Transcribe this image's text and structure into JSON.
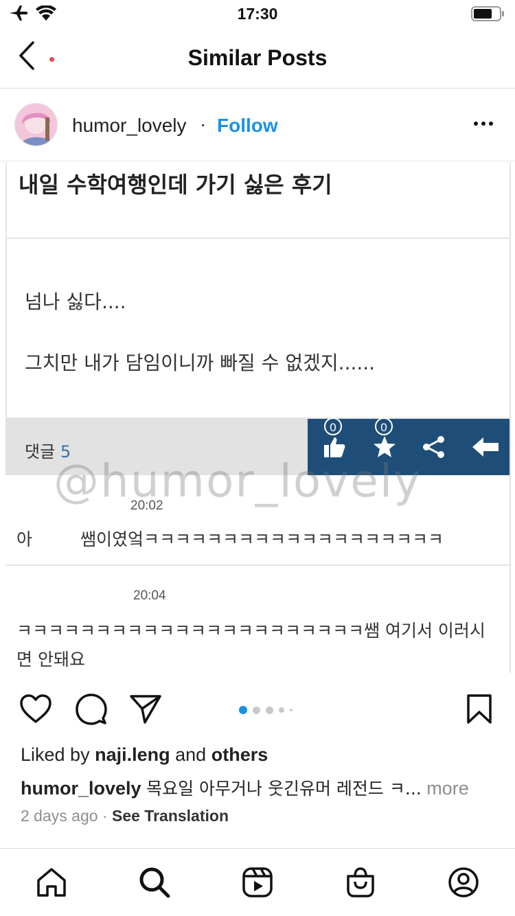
{
  "status_bar": {
    "time": "17:30"
  },
  "header": {
    "title": "Similar Posts"
  },
  "post": {
    "username": "humor_lovely",
    "separator": "·",
    "follow_label": "Follow"
  },
  "image_content": {
    "title": "내일 수학여행인데 가기 싫은 후기",
    "line1": "넘나 싫다....",
    "line2": "그치만 내가 담임이니까 빠질 수 없겠지......",
    "comment_label": "댓글",
    "comment_count": "5",
    "like_count": "0",
    "star_count": "0",
    "watermark": "@humor_lovely",
    "comment1_time": "20:02",
    "comment1_author": "아",
    "comment1_text": "쌤이였엌ㅋㅋㅋㅋㅋㅋㅋㅋㅋㅋㅋㅋㅋㅋㅋㅋㅋㅋㅋ",
    "comment2_time": "20:04",
    "comment2_text": "ㅋㅋㅋㅋㅋㅋㅋㅋㅋㅋㅋㅋㅋㅋㅋㅋㅋㅋㅋㅋㅋㅋ쌤 여기서 이러시면 안돼요"
  },
  "engagement": {
    "liked_by_prefix": "Liked by",
    "liked_by_user": "naji.leng",
    "liked_by_and": "and",
    "liked_by_others": "others",
    "caption_user": "humor_lovely",
    "caption_text": "목요일 아무거나 웃긴유머 레전드 ㅋ...",
    "caption_more": "more",
    "time_ago": "2 days ago",
    "meta_sep": "·",
    "see_translation": "See Translation"
  },
  "carousel": {
    "total": 5,
    "active": 1
  },
  "colors": {
    "accent": "#1a91e6",
    "toolbar": "#1e4e78",
    "notification": "#ed4956"
  },
  "icons": {
    "status": [
      "airplane-icon",
      "wifi-icon",
      "battery-icon"
    ],
    "actions": [
      "heart-icon",
      "comment-icon",
      "share-icon",
      "bookmark-icon"
    ],
    "tabs": [
      "home-icon",
      "search-icon",
      "reels-icon",
      "shop-icon",
      "profile-icon"
    ]
  }
}
